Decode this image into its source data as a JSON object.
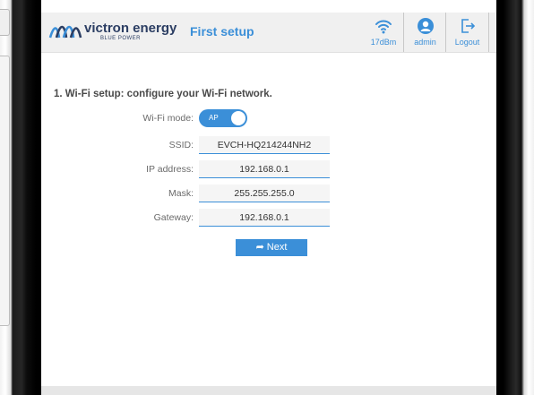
{
  "header": {
    "brand_name": "victron energy",
    "brand_tagline": "BLUE POWER",
    "title": "First setup",
    "wifi_signal": "17dBm",
    "user_label": "admin",
    "logout_label": "Logout",
    "icons": {
      "logo": "victron-wave-logo",
      "wifi": "wifi-icon",
      "user": "user-icon",
      "logout": "logout-icon"
    }
  },
  "main": {
    "section_title": "1. Wi-Fi setup: configure your Wi-Fi network.",
    "wifi_mode": {
      "label": "Wi-Fi mode:",
      "value": "AP"
    },
    "fields": {
      "ssid": {
        "label": "SSID:",
        "value": "EVCH-HQ214244NH2"
      },
      "ip_address": {
        "label": "IP address:",
        "value": "192.168.0.1"
      },
      "mask": {
        "label": "Mask:",
        "value": "255.255.255.0"
      },
      "gateway": {
        "label": "Gateway:",
        "value": "192.168.0.1"
      }
    },
    "next_button": {
      "label": "Next",
      "icon": "share-arrow-icon"
    }
  },
  "colors": {
    "accent": "#3b8fd8",
    "brand_text": "#2c3e63",
    "header_bg": "#f0f0f0"
  }
}
